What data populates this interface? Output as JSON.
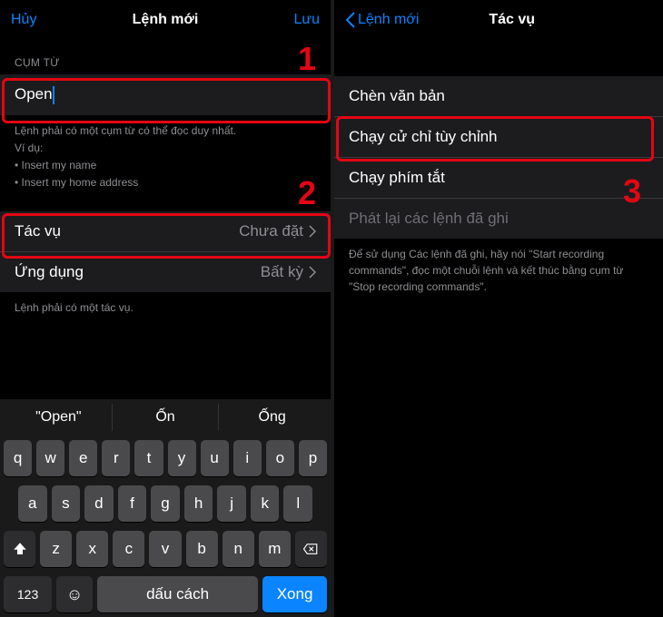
{
  "left": {
    "nav": {
      "cancel": "Hủy",
      "title": "Lệnh mới",
      "save": "Lưu"
    },
    "section_phrase": "CỤM TỪ",
    "phrase_value": "Open",
    "helper_intro": "Lệnh phải có một cụm từ có thể đọc duy nhất.",
    "helper_eg": "Ví dụ:",
    "helper_items": [
      "Insert my name",
      "Insert my home address"
    ],
    "task_label": "Tác vụ",
    "task_value": "Chưa đặt",
    "app_label": "Ứng dụng",
    "app_value": "Bất kỳ",
    "footer": "Lệnh phải có một tác vụ.",
    "annotations": {
      "n1": "1",
      "n2": "2"
    }
  },
  "right": {
    "nav": {
      "back": "Lệnh mới",
      "title": "Tác vụ"
    },
    "options": [
      "Chèn văn bản",
      "Chạy cử chỉ tùy chỉnh",
      "Chạy phím tắt",
      "Phát lại các lệnh đã ghi"
    ],
    "footer": "Để sử dụng Các lệnh đã ghi, hãy nói \"Start recording commands\", đọc một chuỗi lệnh và kết thúc bằng cụm từ \"Stop recording commands\".",
    "annotations": {
      "n3": "3"
    }
  },
  "keyboard": {
    "suggestions": [
      "\"Open\"",
      "Ốn",
      "Ống"
    ],
    "row1": [
      "q",
      "w",
      "e",
      "r",
      "t",
      "y",
      "u",
      "i",
      "o",
      "p"
    ],
    "row2": [
      "a",
      "s",
      "d",
      "f",
      "g",
      "h",
      "j",
      "k",
      "l"
    ],
    "row3": [
      "z",
      "x",
      "c",
      "v",
      "b",
      "n",
      "m"
    ],
    "numbers_key": "123",
    "space_label": "dấu cách",
    "done_label": "Xong"
  }
}
